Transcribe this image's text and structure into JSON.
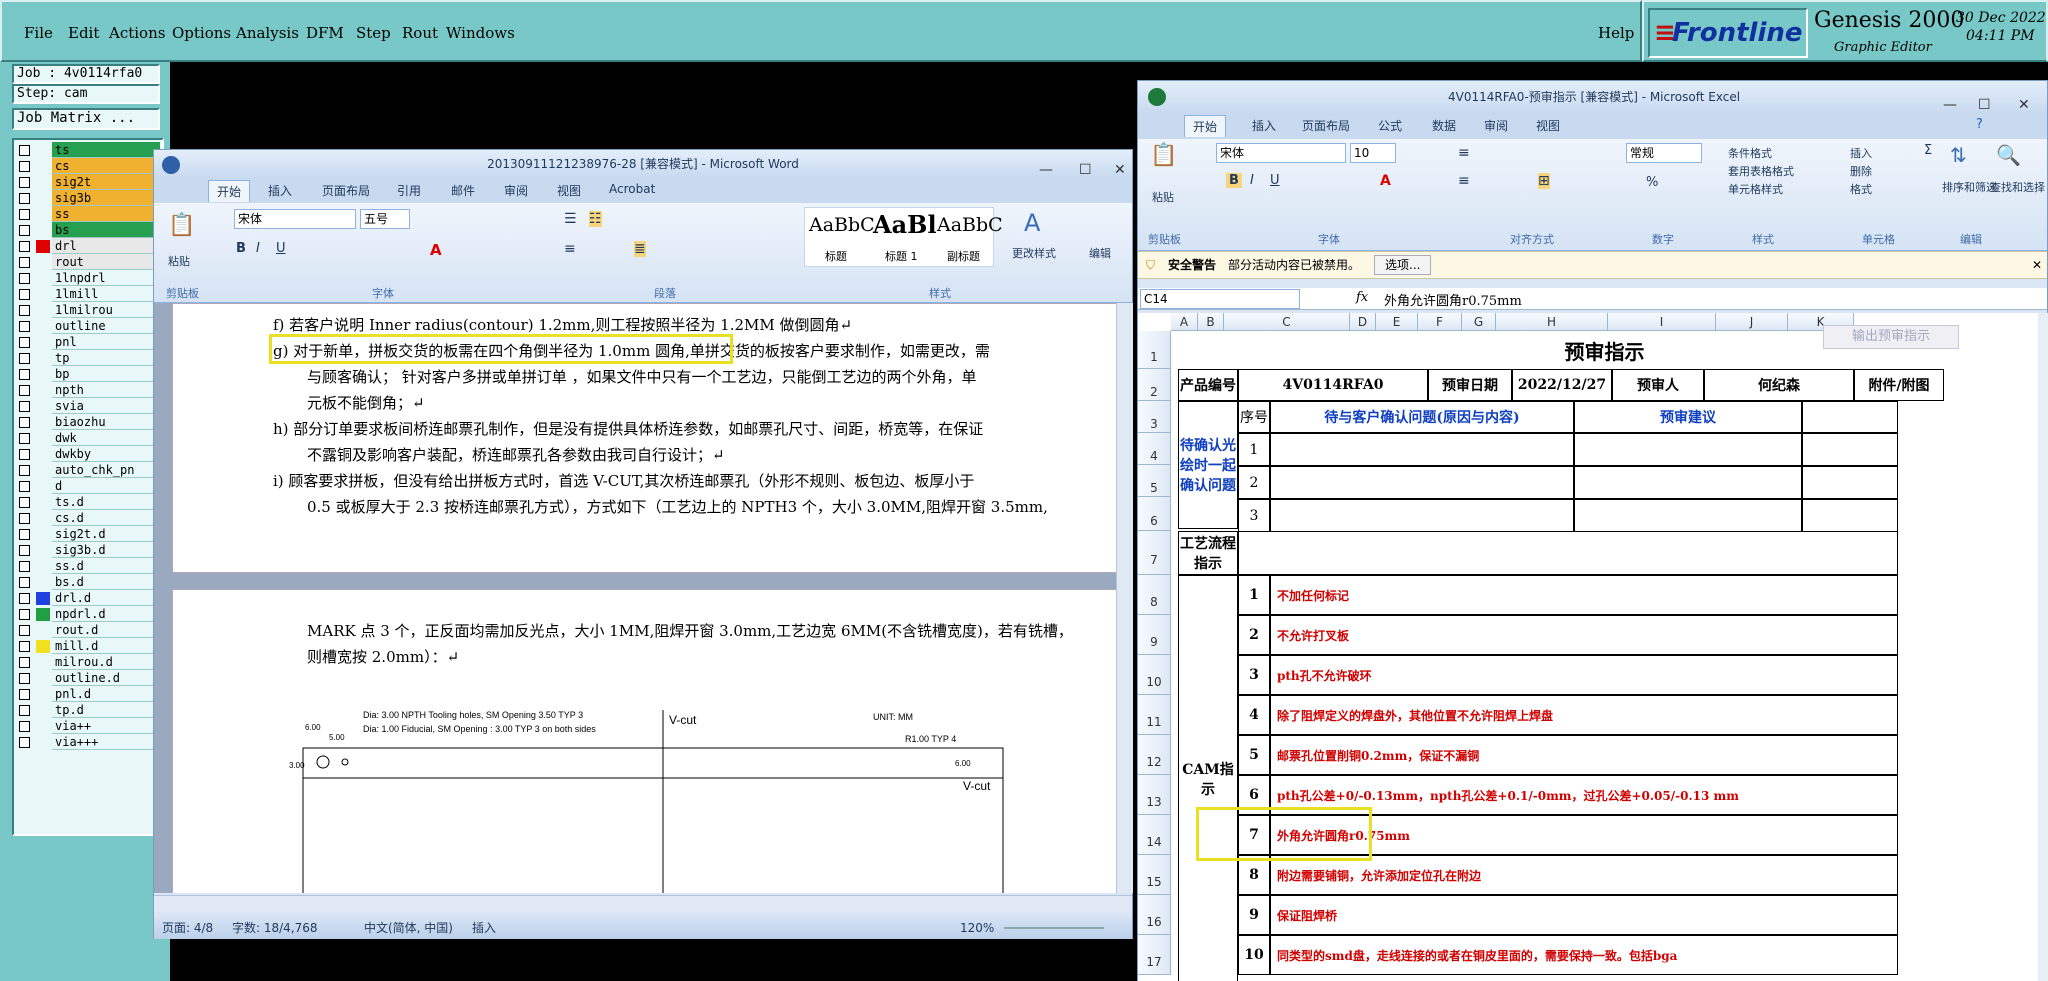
{
  "genesis": {
    "menu": [
      "File",
      "Edit",
      "Actions",
      "Options",
      "Analysis",
      "DFM",
      "Step",
      "Rout",
      "Windows"
    ],
    "help": "Help",
    "brand": "Frontline",
    "product": "Genesis 2000",
    "product_sub": "Graphic Editor",
    "date": "30 Dec 2022",
    "time": "04:11 PM",
    "job": "Job : 4v0114rfa0",
    "step": "Step: cam",
    "job_matrix": "Job Matrix ...",
    "layers": [
      {
        "name": "ts",
        "color": "#26a050"
      },
      {
        "name": "cs",
        "color": "#f0b030"
      },
      {
        "name": "sig2t",
        "color": "#f0b030"
      },
      {
        "name": "sig3b",
        "color": "#f0b030"
      },
      {
        "name": "ss",
        "color": "#f0b030"
      },
      {
        "name": "bs",
        "color": "#26a050"
      },
      {
        "name": "drl",
        "color": "#e8e8e8",
        "swatch": "#e00000"
      },
      {
        "name": "rout",
        "color": "#e8e8e8"
      },
      {
        "name": "1lnpdrl",
        "color": "#e8f8f8"
      },
      {
        "name": "1lmill",
        "color": "#e8f8f8"
      },
      {
        "name": "1lmilrou",
        "color": "#e8f8f8"
      },
      {
        "name": "outline",
        "color": "#e8f8f8"
      },
      {
        "name": "pnl",
        "color": "#e8f8f8"
      },
      {
        "name": "tp",
        "color": "#e8f8f8"
      },
      {
        "name": "bp",
        "color": "#e8f8f8"
      },
      {
        "name": "npth",
        "color": "#e8f8f8"
      },
      {
        "name": "svia",
        "color": "#e8f8f8"
      },
      {
        "name": "biaozhu",
        "color": "#e8f8f8"
      },
      {
        "name": "dwk",
        "color": "#e8f8f8"
      },
      {
        "name": "dwkby",
        "color": "#e8f8f8"
      },
      {
        "name": "auto_chk_pn",
        "color": "#e8f8f8"
      },
      {
        "name": "d",
        "color": "#e8f8f8"
      },
      {
        "name": "ts.d",
        "color": "#e8f8f8"
      },
      {
        "name": "cs.d",
        "color": "#e8f8f8"
      },
      {
        "name": "sig2t.d",
        "color": "#e8f8f8"
      },
      {
        "name": "sig3b.d",
        "color": "#e8f8f8"
      },
      {
        "name": "ss.d",
        "color": "#e8f8f8"
      },
      {
        "name": "bs.d",
        "color": "#e8f8f8"
      },
      {
        "name": "drl.d",
        "color": "#e8f8f8",
        "swatch": "#2040e0"
      },
      {
        "name": "npdrl.d",
        "color": "#e8f8f8",
        "swatch": "#20a040"
      },
      {
        "name": "rout.d",
        "color": "#e8f8f8"
      },
      {
        "name": "mill.d",
        "color": "#e8f8f8",
        "swatch": "#f0e020"
      },
      {
        "name": "milrou.d",
        "color": "#e8f8f8"
      },
      {
        "name": "outline.d",
        "color": "#e8f8f8"
      },
      {
        "name": "pnl.d",
        "color": "#e8f8f8"
      },
      {
        "name": "tp.d",
        "color": "#e8f8f8"
      },
      {
        "name": "via++",
        "color": "#e8f8f8"
      },
      {
        "name": "via+++",
        "color": "#e8f8f8"
      }
    ]
  },
  "word": {
    "title": "20130911121238976-28 [兼容模式] - Microsoft Word",
    "tabs": [
      "开始",
      "插入",
      "页面布局",
      "引用",
      "邮件",
      "审阅",
      "视图",
      "Acrobat"
    ],
    "font": "宋体",
    "size": "五号",
    "paste": "粘贴",
    "styles": [
      {
        "sample": "AaBbC",
        "name": "标题"
      },
      {
        "sample": "AaBl",
        "name": "标题 1"
      },
      {
        "sample": "AaBbC",
        "name": "副标题"
      }
    ],
    "change_styles": "更改样式",
    "edit": "编辑",
    "groups": [
      "剪贴板",
      "字体",
      "段落",
      "样式"
    ],
    "lines": [
      "f) 若客户说明 Inner radius(contour) 1.2mm,则工程按照半径为 1.2MM 做倒圆角↵",
      "g) 对于新单，拼板交货的板需在四个角倒半径为 1.0mm 圆角,单拼交货的板按客户要求制作，如需更改，需",
      "与顾客确认； 针对客户多拼或单拼订单 ，如果文件中只有一个工艺边，只能倒工艺边的两个外角，单",
      "元板不能倒角；↵",
      "h) 部分订单要求板间桥连邮票孔制作，但是没有提供具体桥连参数，如邮票孔尺寸、间距，桥宽等，在保证",
      "不露铜及影响客户装配，桥连邮票孔各参数由我司自行设计；↵",
      "i) 顾客要求拼板，但没有给出拼板方式时，首选 V-CUT,其次桥连邮票孔（外形不规则、板包边、板厚小于",
      "0.5 或板厚大于 2.3 按桥连邮票孔方式），方式如下（工艺边上的 NPTH3 个，大小 3.0MM,阻焊开窗 3.5mm,",
      "MARK 点 3 个，正反面均需加反光点，大小 1MM,阻焊开窗 3.0mm,工艺边宽 6MM(不含铣槽宽度)，若有铣槽，",
      "则槽宽按 2.0mm）：↵"
    ],
    "drawing": {
      "note1": "Dia: 3.00 NPTH Tooling holes, SM Opening 3.50 TYP 3",
      "note2": "Dia: 1.00 Fiducial, SM Opening : 3.00 TYP 3 on both sides",
      "vcut": "V-cut",
      "unit": "UNIT: MM",
      "r": "R1.00 TYP 4",
      "vcut2": "V-cut",
      "d1": "6.00",
      "d2": "5.00",
      "d3": "3.00",
      "d4": "6.00"
    },
    "status": {
      "page": "页面: 4/8",
      "words": "字数: 18/4,768",
      "lang": "中文(简体, 中国)",
      "mode": "插入",
      "zoom": "120%"
    }
  },
  "excel": {
    "title": "4V0114RFA0-预审指示 [兼容模式] - Microsoft Excel",
    "tabs": [
      "开始",
      "插入",
      "页面布局",
      "公式",
      "数据",
      "审阅",
      "视图"
    ],
    "font": "宋体",
    "size": "10",
    "number_format": "常规",
    "groups": [
      "剪贴板",
      "字体",
      "对齐方式",
      "数字",
      "样式",
      "单元格",
      "编辑"
    ],
    "style_btns": [
      "条件格式",
      "套用表格格式",
      "单元格样式"
    ],
    "cell_btns": [
      "插入",
      "删除",
      "格式"
    ],
    "edit_btns": [
      "排序和筛选",
      "查找和选择"
    ],
    "paste": "粘贴",
    "warning_title": "安全警告",
    "warning_text": "部分活动内容已被禁用。",
    "warning_btn": "选项...",
    "cell_ref": "C14",
    "fx": "fx",
    "formula": "外角允许圆角r0.75mm",
    "cols": [
      "A",
      "B",
      "C",
      "D",
      "E",
      "F",
      "G",
      "H",
      "I",
      "J",
      "K"
    ],
    "rows": [
      "1",
      "2",
      "3",
      "4",
      "5",
      "6",
      "7",
      "8",
      "9",
      "10",
      "11",
      "12",
      "13",
      "14",
      "15",
      "16",
      "17"
    ],
    "sheet_title": "预审指示",
    "export_btn": "输出预审指示",
    "product_no_label": "产品编号",
    "product_no": "4V0114RFA0",
    "date_label": "预审日期",
    "date": "2022/12/27",
    "reviewer_label": "预审人",
    "reviewer": "何纪森",
    "attach_label": "附件/附图",
    "seq": "序号",
    "issue_header": "待与客户确认问题(原因与内容)",
    "advice_header": "预审建议",
    "confirm_label": "待确认光绘时一起确认问题",
    "confirm_nums": [
      "1",
      "2",
      "3"
    ],
    "process_label": "工艺流程指示",
    "cam_label": "CAM指示",
    "cam_items": [
      {
        "n": "1",
        "t": "不加任何标记"
      },
      {
        "n": "2",
        "t": "不允许打叉板"
      },
      {
        "n": "3",
        "t": "pth孔不允许破环"
      },
      {
        "n": "4",
        "t": "除了阻焊定义的焊盘外，其他位置不允许阻焊上焊盘"
      },
      {
        "n": "5",
        "t": "邮票孔位置削铜0.2mm，保证不漏铜"
      },
      {
        "n": "6",
        "t": "pth孔公差+0/-0.13mm，npth孔公差+0.1/-0mm，过孔公差+0.05/-0.13 mm"
      },
      {
        "n": "7",
        "t": "外角允许圆角r0.75mm"
      },
      {
        "n": "8",
        "t": "附边需要铺铜，允许添加定位孔在附边"
      },
      {
        "n": "9",
        "t": "保证阻焊桥"
      },
      {
        "n": "10",
        "t": "同类型的smd盘，走线连接的或者在铜皮里面的，需要保持一致。包括bga"
      }
    ]
  }
}
